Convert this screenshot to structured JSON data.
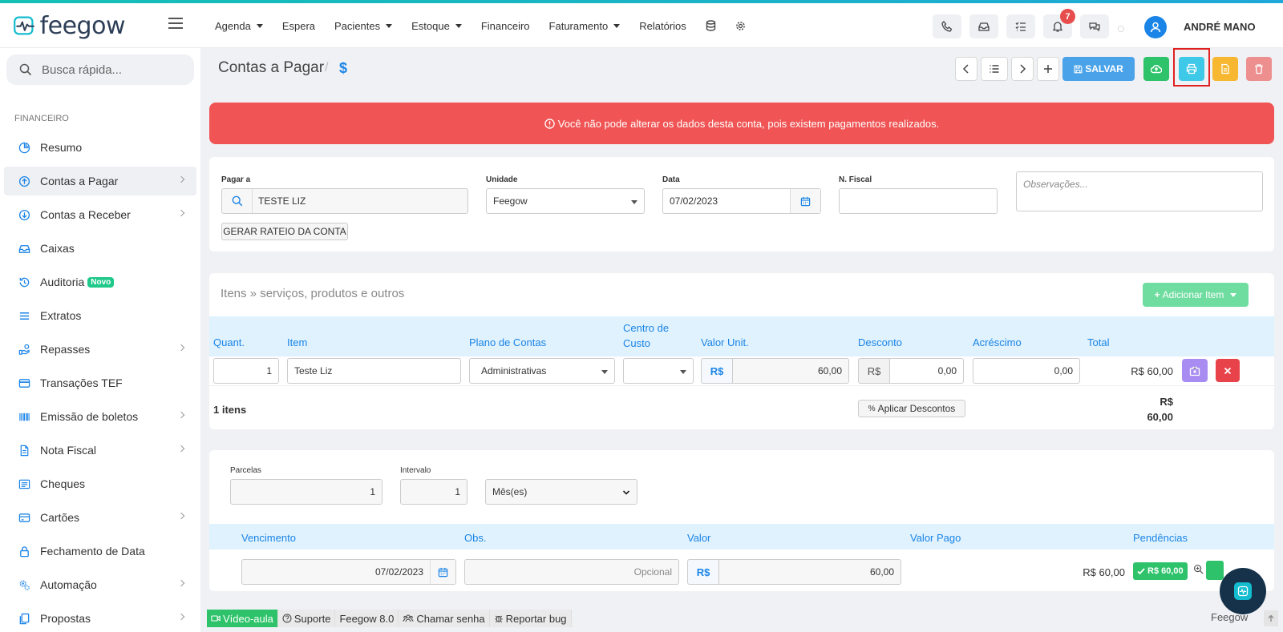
{
  "app": {
    "logo_text": "feegow",
    "brand_color": "#14c0b4",
    "accent": "#1b84e7"
  },
  "topnav": {
    "items": [
      {
        "label": "Agenda",
        "dropdown": true
      },
      {
        "label": "Espera",
        "dropdown": false
      },
      {
        "label": "Pacientes",
        "dropdown": true
      },
      {
        "label": "Estoque",
        "dropdown": true
      },
      {
        "label": "Financeiro",
        "dropdown": false
      },
      {
        "label": "Faturamento",
        "dropdown": true
      },
      {
        "label": "Relatórios",
        "dropdown": false
      }
    ],
    "notifications_count": "7",
    "username": "ANDRÉ MANO"
  },
  "sidebar": {
    "search_placeholder": "Busca rápida...",
    "section": "FINANCEIRO",
    "items": [
      {
        "label": "Resumo",
        "icon": "chart-pie-icon",
        "chevron": false
      },
      {
        "label": "Contas a Pagar",
        "icon": "arrow-up-circle-icon",
        "chevron": true,
        "active": true
      },
      {
        "label": "Contas a Receber",
        "icon": "arrow-down-circle-icon",
        "chevron": true
      },
      {
        "label": "Caixas",
        "icon": "inbox-icon",
        "chevron": false
      },
      {
        "label": "Auditoria",
        "icon": "history-icon",
        "chevron": false,
        "badge": "Novo"
      },
      {
        "label": "Extratos",
        "icon": "list-icon",
        "chevron": false
      },
      {
        "label": "Repasses",
        "icon": "hand-coins-icon",
        "chevron": true
      },
      {
        "label": "Transações TEF",
        "icon": "credit-card-icon",
        "chevron": false
      },
      {
        "label": "Emissão de boletos",
        "icon": "barcode-icon",
        "chevron": true
      },
      {
        "label": "Nota Fiscal",
        "icon": "file-icon",
        "chevron": true
      },
      {
        "label": "Cheques",
        "icon": "cheque-icon",
        "chevron": false
      },
      {
        "label": "Cartões",
        "icon": "card-icon",
        "chevron": true
      },
      {
        "label": "Fechamento de Data",
        "icon": "lock-icon",
        "chevron": false
      },
      {
        "label": "Automação",
        "icon": "gears-icon",
        "chevron": true
      },
      {
        "label": "Propostas",
        "icon": "copy-icon",
        "chevron": true
      }
    ]
  },
  "page": {
    "title": "Contas a Pagar",
    "separator": "/",
    "dollar": "$",
    "save_label": "SALVAR",
    "alert": "Você não pode alterar os dados desta conta, pois existem pagamentos realizados."
  },
  "form": {
    "pagar_a_label": "Pagar a",
    "pagar_a_value": "TESTE LIZ",
    "rateio_label": "GERAR RATEIO DA CONTA",
    "unidade_label": "Unidade",
    "unidade_value": "Feegow",
    "data_label": "Data",
    "data_value": "07/02/2023",
    "nfiscal_label": "N. Fiscal",
    "nfiscal_value": "",
    "obs_placeholder": "Observações..."
  },
  "items": {
    "title": "Itens » serviços, produtos e outros",
    "add_label": "Adicionar Item",
    "headers": [
      "Quant.",
      "Item",
      "Plano de Contas",
      "Centro de Custo",
      "Valor Unit.",
      "Desconto",
      "Acréscimo",
      "Total"
    ],
    "row": {
      "quant": "1",
      "item": "Teste Liz",
      "plano": "Administrativas",
      "centro": "",
      "currency": "R$",
      "valor_unit": "60,00",
      "desconto": "0,00",
      "acrescimo": "0,00",
      "total": "R$ 60,00"
    },
    "count_label": "1 itens",
    "aplicar_label": "Aplicar Descontos",
    "sum_currency": "R$",
    "sum_value": "60,00"
  },
  "parcelas": {
    "parcelas_label": "Parcelas",
    "parcelas_value": "1",
    "intervalo_label": "Intervalo",
    "intervalo_value": "1",
    "periodo_value": "Mês(es)",
    "headers": [
      "Vencimento",
      "Obs.",
      "Valor",
      "Valor Pago",
      "Pendências"
    ],
    "row": {
      "vencimento": "07/02/2023",
      "obs_placeholder": "Opcional",
      "currency": "R$",
      "valor": "60,00",
      "valor_pago": "R$ 60,00",
      "pendencia": "R$ 60,00"
    }
  },
  "footer": {
    "video": "Vídeo-aula",
    "suporte": "Suporte",
    "version": "Feegow 8.0",
    "senha": "Chamar senha",
    "bug": "Reportar bug",
    "brand": "Feegow"
  }
}
